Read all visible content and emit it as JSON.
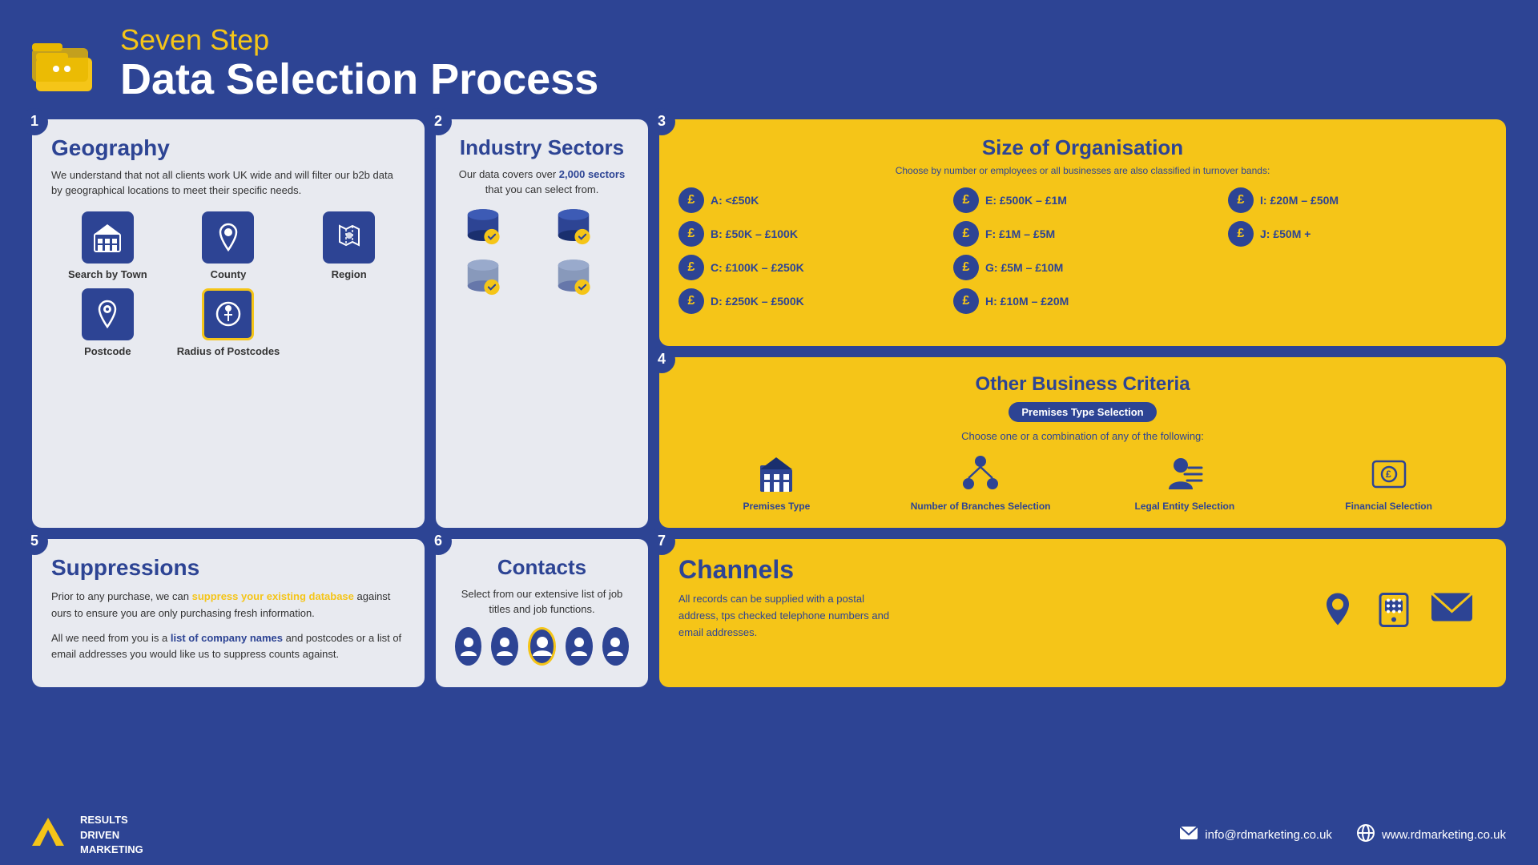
{
  "header": {
    "subtitle": "Seven Step",
    "title": "Data Selection Process"
  },
  "steps": {
    "step1": {
      "number": "1",
      "title": "Geography",
      "description": "We understand that not all clients work UK wide and will filter our b2b data by geographical locations to meet their specific needs.",
      "icons": [
        {
          "label": "Search by Town",
          "icon": "building"
        },
        {
          "label": "County",
          "icon": "pin"
        },
        {
          "label": "Region",
          "icon": "region"
        },
        {
          "label": "Postcode",
          "icon": "postcode"
        },
        {
          "label": "Radius of Postcodes",
          "icon": "radius"
        }
      ]
    },
    "step2": {
      "number": "2",
      "title": "Industry Sectors",
      "description_part1": "Our data covers over ",
      "description_highlight": "2,000 sectors",
      "description_part2": " that you can select from."
    },
    "step3": {
      "number": "3",
      "title": "Size of Organisation",
      "description": "Choose by number or employees or all businesses are also classified in turnover bands:",
      "bands": [
        {
          "label": "A: <£50K"
        },
        {
          "label": "E: £500K – £1M"
        },
        {
          "label": "I: £20M – £50M"
        },
        {
          "label": "B: £50K – £100K"
        },
        {
          "label": "F: £1M – £5M"
        },
        {
          "label": "J: £50M +"
        },
        {
          "label": "C: £100K – £250K"
        },
        {
          "label": "G: £5M – £10M"
        },
        {
          "label": ""
        },
        {
          "label": "D: £250K – £500K"
        },
        {
          "label": "H: £10M – £20M"
        },
        {
          "label": ""
        }
      ]
    },
    "step4": {
      "number": "4",
      "title": "Other Business Criteria",
      "premises_badge": "Premises Type Selection",
      "description": "Choose one or a combination of any of the following:",
      "icons": [
        {
          "label": "Premises Type"
        },
        {
          "label": "Number of Branches Selection"
        },
        {
          "label": "Legal Entity Selection"
        },
        {
          "label": "Financial Selection"
        }
      ]
    },
    "step5": {
      "number": "5",
      "title": "Suppressions",
      "para1": "Prior to any purchase, we can ",
      "para1_highlight": "suppress your existing database",
      "para1_end": " against ours to ensure you are only purchasing fresh information.",
      "para2_start": "All we need from you is a ",
      "para2_highlight": "list of company names",
      "para2_end": " and postcodes or a list of email addresses you would like us to suppress counts against."
    },
    "step6": {
      "number": "6",
      "title": "Contacts",
      "description": "Select from our extensive list of job titles and job functions."
    },
    "step7": {
      "number": "7",
      "title": "Channels",
      "description": "All records can be supplied with a postal address, tps checked telephone numbers and email addresses."
    }
  },
  "footer": {
    "logo_line1": "RESULTS",
    "logo_line2": "DRIVEN",
    "logo_line3": "MARKETING",
    "email": "info@rdmarketing.co.uk",
    "website": "www.rdmarketing.co.uk"
  }
}
